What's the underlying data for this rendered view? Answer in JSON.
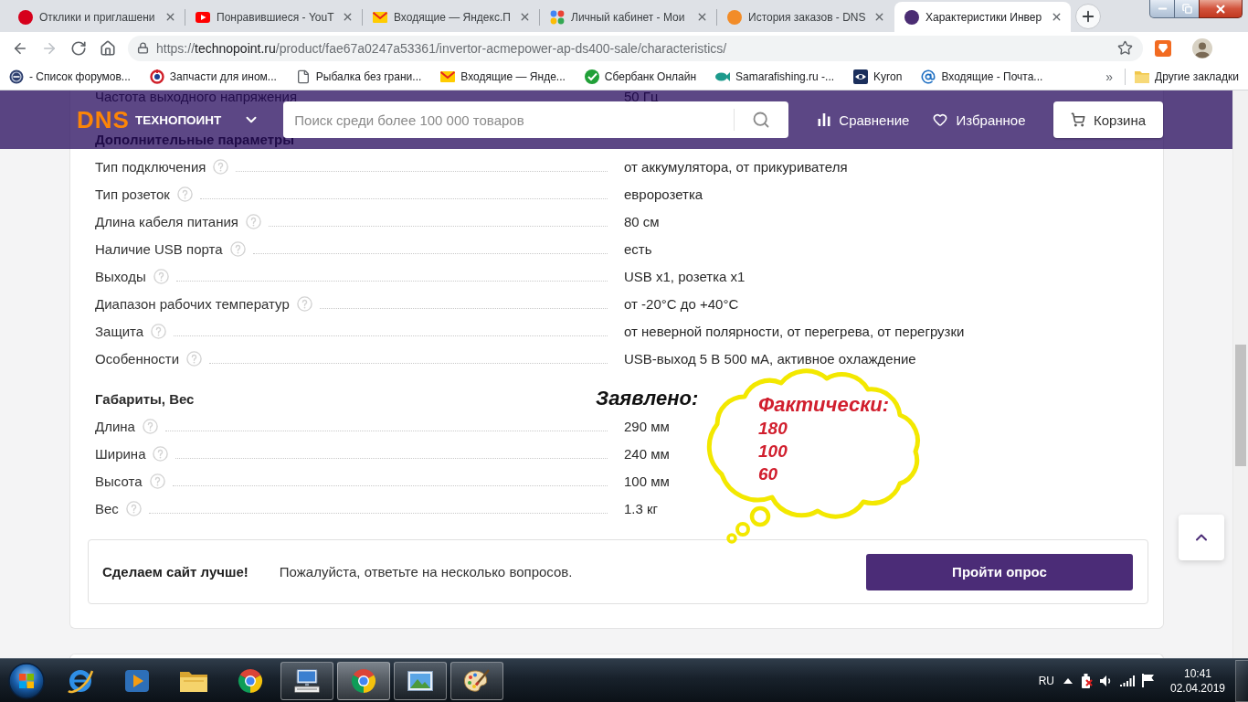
{
  "browser": {
    "tabs": [
      {
        "title": "Отклики и приглашени",
        "kind": "circle",
        "color": "#d6001c",
        "selected": false
      },
      {
        "title": "Понравившиеся - YouT",
        "kind": "video",
        "selected": false
      },
      {
        "title": "Входящие — Яндекс.П",
        "kind": "mail",
        "selected": false
      },
      {
        "title": "Личный кабинет - Мои",
        "kind": "dots",
        "selected": false
      },
      {
        "title": "История заказов - DNS",
        "kind": "circle",
        "color": "#f28c28",
        "selected": false
      },
      {
        "title": "Характеристики Инвер",
        "kind": "circle",
        "color": "#4b2d73",
        "selected": true
      }
    ],
    "nav": [
      {
        "kind": "back",
        "disabled": false
      },
      {
        "kind": "forward",
        "disabled": true
      },
      {
        "kind": "reload",
        "disabled": false
      },
      {
        "kind": "home",
        "disabled": false
      }
    ],
    "url": {
      "scheme": "https://",
      "host": "technopoint.ru",
      "path": "/product/fae67a0247a53361/invertor-acmepower-ap-ds400-sale/characteristics/"
    },
    "bookmarks": [
      {
        "label": "- Список форумов...",
        "kind": "forum"
      },
      {
        "label": "Запчасти для ином...",
        "kind": "parts"
      },
      {
        "label": "Рыбалка без грани...",
        "kind": "page"
      },
      {
        "label": "Входящие — Янде...",
        "kind": "mail"
      },
      {
        "label": "Сбербанк Онлайн",
        "kind": "bank"
      },
      {
        "label": "Samarafishing.ru -...",
        "kind": "fish"
      },
      {
        "label": "Kyron",
        "kind": "eye"
      },
      {
        "label": "Входящие - Почта...",
        "kind": "at"
      }
    ],
    "more_bookmarks": "»",
    "other_bookmarks": "Другие закладки"
  },
  "header": {
    "logo_mark": "DNS",
    "logo_name": "ТЕХНОПОИНТ",
    "search_placeholder": "Поиск среди более 100 000 товаров",
    "links": [
      {
        "label": "Сравнение",
        "kind": "compare"
      },
      {
        "label": "Избранное",
        "kind": "favorites"
      }
    ],
    "cart_label": "Корзина"
  },
  "specs": {
    "groups": [
      {
        "rows": [
          {
            "name": "Частота выходного напряжения",
            "value": "50 Гц"
          }
        ]
      },
      {
        "title": "Дополнительные параметры",
        "rows": [
          {
            "name": "Тип подключения",
            "value": "от аккумулятора, от прикуривателя"
          },
          {
            "name": "Тип розеток",
            "value": "евророзетка"
          },
          {
            "name": "Длина кабеля питания",
            "value": "80 см"
          },
          {
            "name": "Наличие USB порта",
            "value": "есть"
          },
          {
            "name": "Выходы",
            "value": "USB x1, розетка x1"
          },
          {
            "name": "Диапазон рабочих температур",
            "value": "от -20°C до +40°C"
          },
          {
            "name": "Защита",
            "value": "от неверной полярности, от перегрева, от перегрузки"
          },
          {
            "name": "Особенности",
            "value": "USB-выход 5 В 500 мА, активное охлаждение"
          }
        ]
      },
      {
        "title": "Габариты, Вес",
        "rows": [
          {
            "name": "Длина",
            "value": "290 мм"
          },
          {
            "name": "Ширина",
            "value": "240 мм"
          },
          {
            "name": "Высота",
            "value": "100 мм"
          },
          {
            "name": "Вес",
            "value": "1.3 кг"
          }
        ]
      }
    ]
  },
  "survey": {
    "title": "Сделаем сайт лучше!",
    "text": "Пожалуйста, ответьте на несколько вопросов.",
    "button": "Пройти опрос"
  },
  "annotation": {
    "declared": "Заявлено:",
    "actual_title": "Фактически:",
    "actual_values": [
      "180",
      "100",
      "60"
    ]
  },
  "taskbar": {
    "apps": [
      {
        "kind": "explorer",
        "running": false,
        "selected": false
      },
      {
        "kind": "media",
        "running": false,
        "selected": false
      },
      {
        "kind": "folder",
        "running": false,
        "selected": false
      },
      {
        "kind": "browser",
        "running": false,
        "selected": false
      },
      {
        "kind": "remote",
        "running": true,
        "selected": false
      },
      {
        "kind": "browser",
        "running": true,
        "selected": true
      },
      {
        "kind": "viewer",
        "running": true,
        "selected": false
      },
      {
        "kind": "paint",
        "running": true,
        "selected": false
      }
    ],
    "language": "RU",
    "time": "10:41",
    "date": "02.04.2019"
  }
}
